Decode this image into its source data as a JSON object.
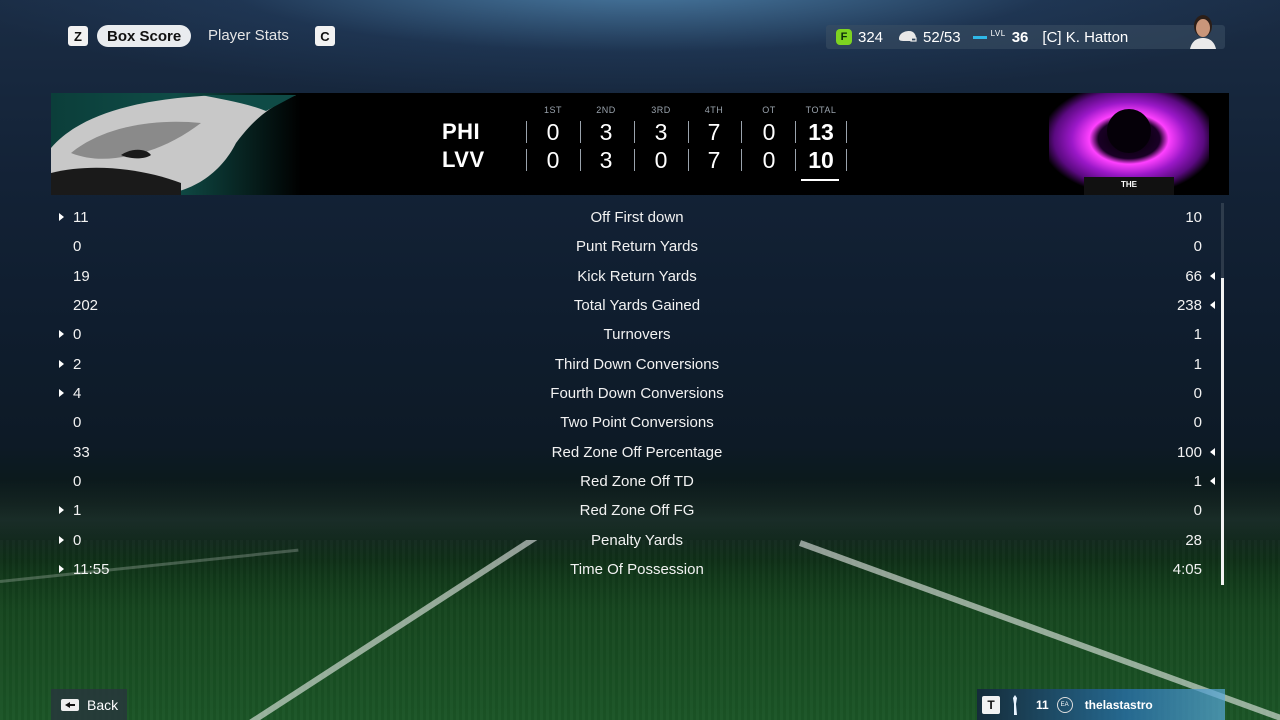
{
  "topbar": {
    "left_key": "Z",
    "right_key": "C",
    "tabs": [
      {
        "label": "Box Score",
        "active": true
      },
      {
        "label": "Player Stats",
        "active": false
      }
    ],
    "profile": {
      "coin_letter": "F",
      "coins": "324",
      "roster": "52/53",
      "level_label": "LVL",
      "level": "36",
      "coach": "[C]  K. Hatton"
    }
  },
  "scoreboard": {
    "quarter_headers": [
      "1ST",
      "2ND",
      "3RD",
      "4TH",
      "OT",
      "TOTAL"
    ],
    "teams": [
      {
        "abbr": "PHI",
        "scores": [
          "0",
          "3",
          "3",
          "7",
          "0",
          "13"
        ]
      },
      {
        "abbr": "LVV",
        "scores": [
          "0",
          "3",
          "0",
          "7",
          "0",
          "10"
        ]
      }
    ],
    "away_logo_text": "THE"
  },
  "stats": [
    {
      "label": "Off First down",
      "home": "11",
      "away": "10",
      "home_arrow": true,
      "away_arrow": false
    },
    {
      "label": "Punt Return Yards",
      "home": "0",
      "away": "0",
      "home_arrow": false,
      "away_arrow": false
    },
    {
      "label": "Kick Return Yards",
      "home": "19",
      "away": "66",
      "home_arrow": false,
      "away_arrow": true
    },
    {
      "label": "Total Yards Gained",
      "home": "202",
      "away": "238",
      "home_arrow": false,
      "away_arrow": true
    },
    {
      "label": "Turnovers",
      "home": "0",
      "away": "1",
      "home_arrow": true,
      "away_arrow": false
    },
    {
      "label": "Third Down Conversions",
      "home": "2",
      "away": "1",
      "home_arrow": true,
      "away_arrow": false
    },
    {
      "label": "Fourth Down Conversions",
      "home": "4",
      "away": "0",
      "home_arrow": true,
      "away_arrow": false
    },
    {
      "label": "Two Point Conversions",
      "home": "0",
      "away": "0",
      "home_arrow": false,
      "away_arrow": false
    },
    {
      "label": "Red Zone Off Percentage",
      "home": "33",
      "away": "100",
      "home_arrow": false,
      "away_arrow": true
    },
    {
      "label": "Red Zone Off TD",
      "home": "0",
      "away": "1",
      "home_arrow": false,
      "away_arrow": true
    },
    {
      "label": "Red Zone Off FG",
      "home": "1",
      "away": "0",
      "home_arrow": true,
      "away_arrow": false
    },
    {
      "label": "Penalty Yards",
      "home": "0",
      "away": "28",
      "home_arrow": true,
      "away_arrow": false
    },
    {
      "label": "Time Of Possession",
      "home": "11:55",
      "away": "4:05",
      "home_arrow": true,
      "away_arrow": false
    }
  ],
  "footer": {
    "back_label": "Back",
    "t_key": "T",
    "player_count": "11",
    "gamertag": "thelastastro"
  },
  "colors": {
    "accent_level": "#2fb8e8",
    "coin_green": "#7ed321",
    "eagles_teal": "#0f4b46",
    "vortex_magenta": "#c020e0"
  }
}
